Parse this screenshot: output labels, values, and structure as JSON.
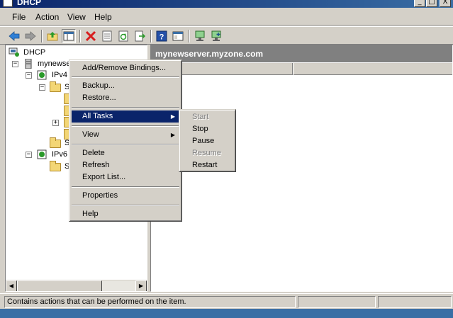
{
  "window": {
    "title": "DHCP",
    "minimize_glyph": "_",
    "maximize_glyph": "□",
    "close_glyph": "X"
  },
  "menubar": {
    "items": [
      "File",
      "Action",
      "View",
      "Help"
    ]
  },
  "toolbar": {
    "icons": [
      "back-icon",
      "forward-icon",
      "up-folder-icon",
      "show-hide-tree-icon",
      "delete-icon",
      "properties-icon",
      "refresh-icon",
      "export-list-icon",
      "help-icon",
      "console-window-icon",
      "server-icon",
      "server-add-icon"
    ]
  },
  "tree": {
    "root": "DHCP",
    "server": "mynewser",
    "ipv4": "IPv4",
    "ipv4_child": "S",
    "child_s2": "S",
    "ipv6": "IPv6",
    "ipv6_child": "S",
    "expanded_glyph": "−",
    "collapsed_glyph": "+",
    "scroll_left_glyph": "◀",
    "scroll_right_glyph": "▶"
  },
  "right_pane": {
    "header": "mynewserver.myzone.com"
  },
  "context_menu": {
    "items": {
      "add_remove_bindings": "Add/Remove Bindings...",
      "backup": "Backup...",
      "restore": "Restore...",
      "all_tasks": "All Tasks",
      "view": "View",
      "delete": "Delete",
      "refresh": "Refresh",
      "export_list": "Export List...",
      "properties": "Properties",
      "help": "Help"
    },
    "submenu_arrow": "▶"
  },
  "submenu": {
    "start": "Start",
    "stop": "Stop",
    "pause": "Pause",
    "resume": "Resume",
    "restart": "Restart"
  },
  "statusbar": {
    "text": "Contains actions that can be performed on the item."
  },
  "colors": {
    "selection": "#0a246a",
    "face": "#d4d0c8",
    "header_gray": "#808080"
  }
}
